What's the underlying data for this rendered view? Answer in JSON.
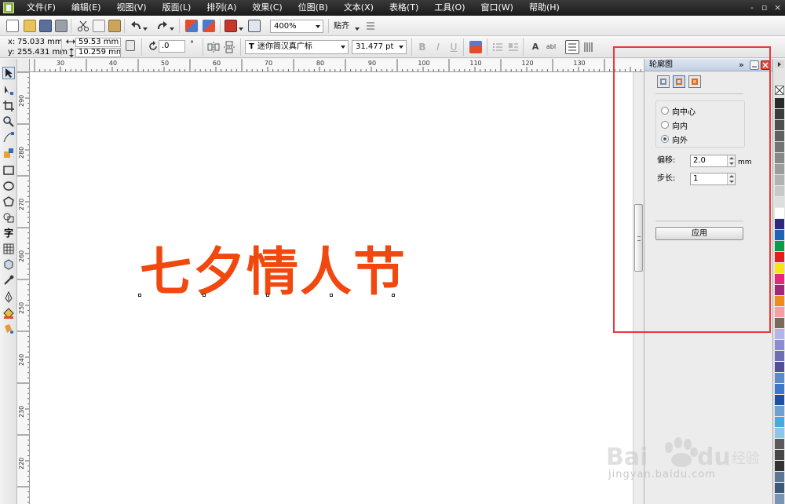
{
  "menubar": {
    "items": [
      "文件(F)",
      "编辑(E)",
      "视图(V)",
      "版面(L)",
      "排列(A)",
      "效果(C)",
      "位图(B)",
      "文本(X)",
      "表格(T)",
      "工具(O)",
      "窗口(W)",
      "帮助(H)"
    ],
    "window_controls": [
      "-",
      "▫",
      "×"
    ]
  },
  "toolbar": {
    "zoom": "400%",
    "snap_label": "贴齐"
  },
  "property_bar": {
    "x_label": "x:",
    "x_value": "75.033 mm",
    "y_label": "y:",
    "y_value": "255.431 mm",
    "width_value": "59.53 mm",
    "height_value": "10.259 mm",
    "rotation_value": ".0",
    "degree_symbol": "°",
    "font_icon": "T",
    "font_name": "迷你简汉真广标",
    "font_size": "31.477 pt"
  },
  "rulers": {
    "top_labels": [
      "30",
      "40",
      "50",
      "60",
      "70",
      "80",
      "90",
      "100",
      "110",
      "120",
      "130"
    ],
    "left_labels": [
      "290",
      "280",
      "270",
      "260",
      "250",
      "240",
      "230",
      "220"
    ]
  },
  "canvas": {
    "text": "七夕情人节",
    "text_color": "#f0480e"
  },
  "docker": {
    "title": "轮廓图",
    "expand_label": "»",
    "options": [
      {
        "label": "向中心",
        "selected": false
      },
      {
        "label": "向内",
        "selected": false
      },
      {
        "label": "向外",
        "selected": true
      }
    ],
    "offset_label": "偏移:",
    "offset_value": "2.0",
    "offset_unit": "mm",
    "step_label": "步长:",
    "step_value": "1",
    "apply_label": "应用"
  },
  "palette": {
    "colors": [
      "#2a2a2a",
      "#3c3c3c",
      "#4e4e4e",
      "#606060",
      "#747474",
      "#888888",
      "#9c9c9c",
      "#b2b2b2",
      "#c8c8c8",
      "#dedede",
      "#ffffff",
      "#2a2a7a",
      "#1e64b4",
      "#0a9a4a",
      "#e61e1e",
      "#f5e614",
      "#e6287a",
      "#a02878",
      "#f08c1e",
      "#f4a0a0",
      "#7a6a5a",
      "#b4b4e6",
      "#8c8cc8",
      "#6e6eb4",
      "#50509a",
      "#5a8ac8",
      "#3c78c8",
      "#1e50a0",
      "#6ea0d2",
      "#46aadc",
      "#8cc8e6",
      "#5a5a5a",
      "#464646",
      "#323232",
      "#5a7896",
      "#3c5a78",
      "#7896b4"
    ]
  },
  "watermark": {
    "brand": "Bai du 经验",
    "url": "jingyan.baidu.com"
  }
}
